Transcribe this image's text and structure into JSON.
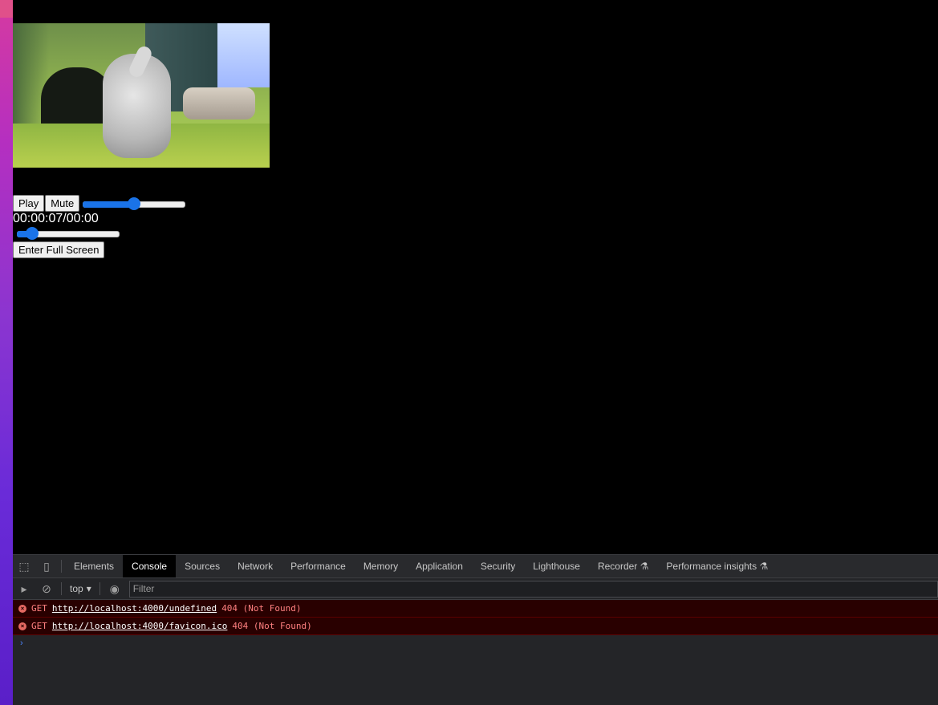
{
  "player": {
    "play_label": "Play",
    "mute_label": "Mute",
    "volume_level": 0.5,
    "time_display": "00:00:07/00:00",
    "seek_level": 0.1,
    "fullscreen_label": "Enter Full Screen"
  },
  "devtools": {
    "tabs": [
      "Elements",
      "Console",
      "Sources",
      "Network",
      "Performance",
      "Memory",
      "Application",
      "Security",
      "Lighthouse",
      "Recorder ⚗",
      "Performance insights ⚗"
    ],
    "active_tab": "Console",
    "context": "top",
    "filter_placeholder": "Filter",
    "logs": [
      {
        "method": "GET",
        "url": "http://localhost:4000/undefined",
        "status": "404 (Not Found)"
      },
      {
        "method": "GET",
        "url": "http://localhost:4000/favicon.ico",
        "status": "404 (Not Found)"
      }
    ],
    "prompt": "›"
  },
  "colors": {
    "accent": "#1a73e8",
    "error_bg": "#290000",
    "error_text": "#ff8080"
  }
}
